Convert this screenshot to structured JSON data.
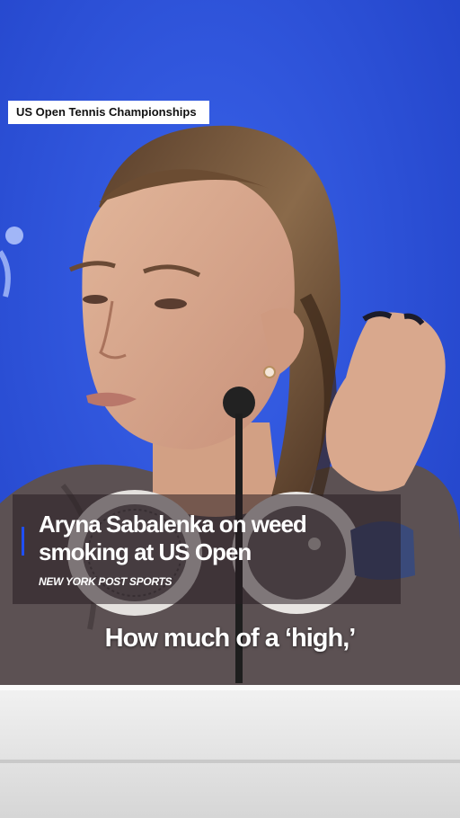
{
  "source_tag": "US Open Tennis Championships",
  "headline": {
    "line1": "Aryna Sabalenka on weed",
    "line2": "smoking at US Open"
  },
  "byline": "NEW YORK POST SPORTS",
  "caption": "How much of a ‘high,’",
  "colors": {
    "backdrop_blue": "#2a4fd8",
    "accent_blue": "#1f4fff",
    "tag_background": "#ffffff",
    "text": "#ffffff"
  }
}
